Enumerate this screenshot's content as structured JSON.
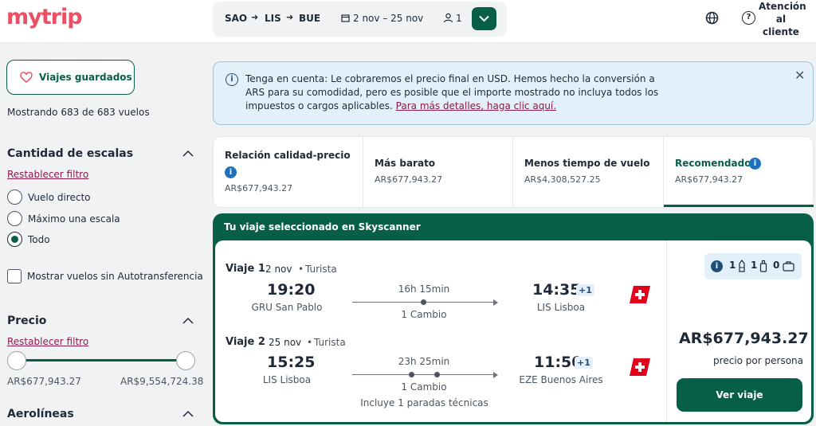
{
  "header": {
    "logo": "mytrip",
    "origin": "SAO",
    "stop": "LIS",
    "destination": "BUE",
    "dates": "2 nov – 25 nov",
    "passengers": "1",
    "help_label": "Atención al cliente"
  },
  "sidebar": {
    "saved_label": "Viajes guardados",
    "showing": "Mostrando 683 de 683 vuelos",
    "stops": {
      "title": "Cantidad de escalas",
      "reset": "Restablecer filtro",
      "options": [
        "Vuelo directo",
        "Máximo una escala",
        "Todo"
      ],
      "selected": "Todo"
    },
    "self_transfer_label": "Mostrar vuelos sin Autotransferencia",
    "price": {
      "title": "Precio",
      "reset": "Restablecer filtro",
      "min": "AR$677,943.27",
      "max": "AR$9,554,724.38"
    },
    "airlines_title": "Aerolíneas"
  },
  "info": {
    "text": "Tenga en cuenta: Le cobraremos el precio final en USD. Hemos hecho la conversión a ARS para su comodidad, pero es posible que el importe mostrado no incluya todos los impuestos o cargos aplicables.",
    "link": "Para más detalles, haga clic aquí."
  },
  "sort_tabs": [
    {
      "title": "Relación calidad-precio",
      "price": "AR$677,943.27"
    },
    {
      "title": "Más barato",
      "price": "AR$677,943.27"
    },
    {
      "title": "Menos tiempo de vuelo",
      "price": "AR$4,308,527.25"
    },
    {
      "title": "Recomendado",
      "price": "AR$677,943.27"
    }
  ],
  "selected_card": {
    "heading": "Tu viaje seleccionado en Skyscanner",
    "legs": [
      {
        "title": "Viaje 1",
        "date": "2 nov",
        "cabin": "Turista",
        "dep_time": "19:20",
        "dep_place": "GRU San Pablo",
        "duration": "16h 15min",
        "stops": "1 Cambio",
        "note": "",
        "arr_time": "14:35",
        "arr_offset": "+1",
        "arr_place": "LIS Lisboa"
      },
      {
        "title": "Viaje 2",
        "date": "25 nov",
        "cabin": "Turista",
        "dep_time": "15:25",
        "dep_place": "LIS Lisboa",
        "duration": "23h 25min",
        "stops": "1 Cambio",
        "note": "Incluye 1 paradas técnicas",
        "arr_time": "11:50",
        "arr_offset": "+1",
        "arr_place": "EZE Buenos Aires"
      }
    ],
    "bags": {
      "personal": "1",
      "carry_on": "1",
      "checked": "0"
    },
    "price": "AR$677,943.27",
    "price_note": "precio por persona",
    "cta": "Ver viaje"
  },
  "colors": {
    "brand": "#ec4f63",
    "primary": "#075f48",
    "link": "#8b1a4a",
    "info_bg": "#e3f0f9"
  }
}
